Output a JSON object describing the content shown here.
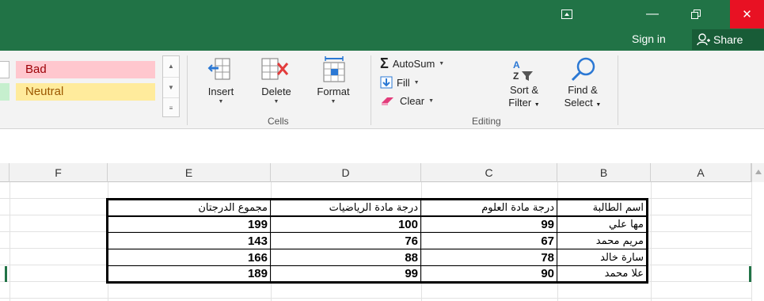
{
  "window": {
    "ribbon_display_icon": "ribbon-display-options-icon",
    "minimize_glyph": "—",
    "maximize_glyph": "🗗",
    "close_glyph": "✕"
  },
  "account": {
    "sign_in": "Sign in",
    "share": "Share"
  },
  "styles": {
    "bad": "Bad",
    "neutral": "Neutral"
  },
  "cells_group": {
    "label": "Cells",
    "insert": "Insert",
    "delete": "Delete",
    "format": "Format"
  },
  "editing_group": {
    "label": "Editing",
    "autosum": "AutoSum",
    "fill": "Fill",
    "clear": "Clear",
    "sort_line1": "Sort &",
    "sort_line2": "Filter",
    "find_line1": "Find &",
    "find_line2": "Select"
  },
  "columns": [
    "F",
    "E",
    "D",
    "C",
    "B",
    "A"
  ],
  "table": {
    "headers": [
      "مجموع الدرجتان",
      "درجة مادة الرياضيات",
      "درجة مادة العلوم",
      "اسم الطالبة"
    ],
    "rows": [
      [
        "199",
        "100",
        "99",
        "مها علي"
      ],
      [
        "143",
        "76",
        "67",
        "مريم محمد"
      ],
      [
        "166",
        "88",
        "78",
        "سارة خالد"
      ],
      [
        "189",
        "99",
        "90",
        "علا محمد"
      ]
    ]
  },
  "colors": {
    "title_bar": "#217346",
    "bad_fill": "#ffc7ce",
    "bad_text": "#9c0006",
    "neutral_fill": "#ffeb9c",
    "neutral_text": "#9c5700",
    "close_button": "#e81123"
  }
}
